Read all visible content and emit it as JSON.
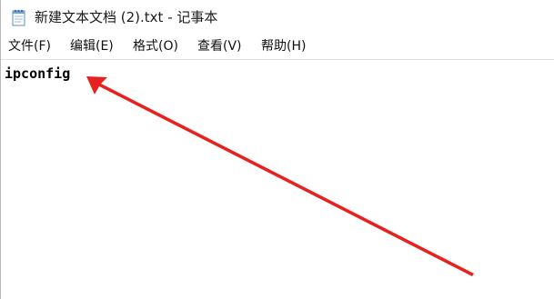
{
  "window": {
    "title": "新建文本文档 (2).txt - 记事本",
    "app_icon": "notepad-icon"
  },
  "menubar": {
    "items": [
      {
        "label": "文件(F)"
      },
      {
        "label": "编辑(E)"
      },
      {
        "label": "格式(O)"
      },
      {
        "label": "查看(V)"
      },
      {
        "label": "帮助(H)"
      }
    ]
  },
  "editor": {
    "content": "ipconfig"
  },
  "annotation": {
    "type": "arrow",
    "color": "#e8211f"
  }
}
